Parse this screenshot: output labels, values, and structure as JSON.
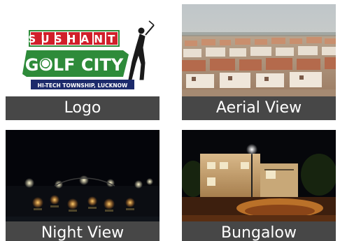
{
  "tiles": [
    {
      "caption": "Logo",
      "logo": {
        "top_word": "SUSHANT",
        "main_word": "GOLF CITY",
        "tagline": "HI-TECH TOWNSHIP, LUCKNOW"
      }
    },
    {
      "caption": "Aerial View"
    },
    {
      "caption": "Night View"
    },
    {
      "caption": "Bungalow"
    }
  ],
  "colors": {
    "caption_bg": "#373737",
    "caption_text": "#ffffff",
    "logo_red": "#d11f2a",
    "logo_green": "#2e8b3a",
    "logo_navy": "#1c2a6b"
  },
  "icons": [
    "golfer-icon"
  ]
}
